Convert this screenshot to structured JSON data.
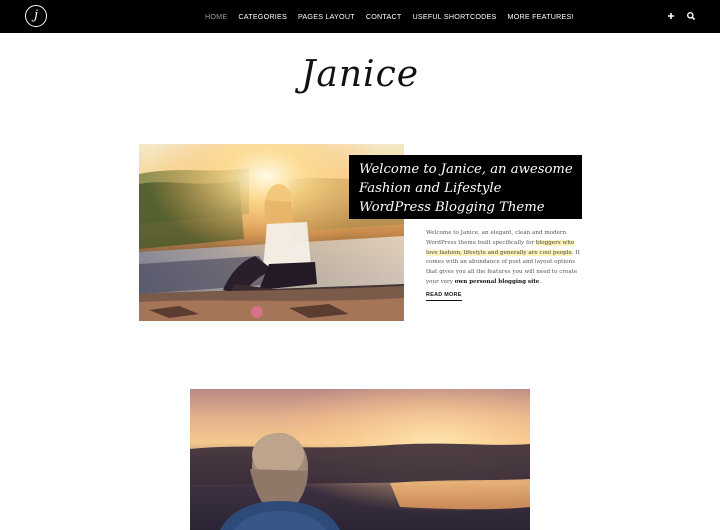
{
  "header": {
    "logo_letter": "j",
    "nav": [
      {
        "label": "HOME",
        "active": true
      },
      {
        "label": "CATEGORIES",
        "active": false
      },
      {
        "label": "PAGES LAYOUT",
        "active": false
      },
      {
        "label": "CONTACT",
        "active": false
      },
      {
        "label": "USEFUL SHORTCODES",
        "active": false
      },
      {
        "label": "MORE FEATURES!",
        "active": false
      }
    ],
    "icons": [
      "plus-icon",
      "search-icon"
    ]
  },
  "site_title": "Janice",
  "post": {
    "title": "Welcome to Janice, an awesome Fashion and Lifestyle WordPress Blogging Theme",
    "excerpt_1": "Welcome to Janice, an elegant, clean and modern WordPress theme built specifically for ",
    "excerpt_highlight": "bloggers who love fashion, lifestyle and generally are cool people",
    "excerpt_2": ". It comes with an abundance of post and layout options that gives you all the features you will need to create your very ",
    "excerpt_bold": "own personal blogging site",
    "excerpt_3": ".",
    "read_more": "READ MORE"
  },
  "colors": {
    "nav_bg": "#000000",
    "highlight": "#fdf4b8",
    "title_box_bg": "#000000"
  }
}
